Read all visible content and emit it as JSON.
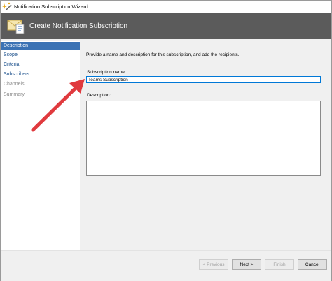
{
  "window": {
    "title": "Notification Subscription Wizard",
    "header_title": "Create Notification Subscription"
  },
  "sidebar": {
    "items": [
      {
        "label": "Description",
        "state": "active"
      },
      {
        "label": "Scope",
        "state": "normal"
      },
      {
        "label": "Criteria",
        "state": "normal"
      },
      {
        "label": "Subscribers",
        "state": "normal"
      },
      {
        "label": "Channels",
        "state": "disabled"
      },
      {
        "label": "Summary",
        "state": "disabled"
      }
    ]
  },
  "main": {
    "intro": "Provide a name and description for this subscription, and add the recipients.",
    "name_label": "Subscription name:",
    "name_value": "Teams Subscription",
    "description_label": "Description:",
    "description_value": ""
  },
  "footer": {
    "previous_label": "< Previous",
    "next_label": "Next >",
    "finish_label": "Finish",
    "cancel_label": "Cancel"
  },
  "colors": {
    "header_bg": "#5b5b5b",
    "active_nav": "#3b72b4",
    "annotation_arrow": "#e03a3e"
  },
  "icons": [
    "wizard-sparkle-icon",
    "notification-envelope-icon",
    "annotation-arrow"
  ]
}
